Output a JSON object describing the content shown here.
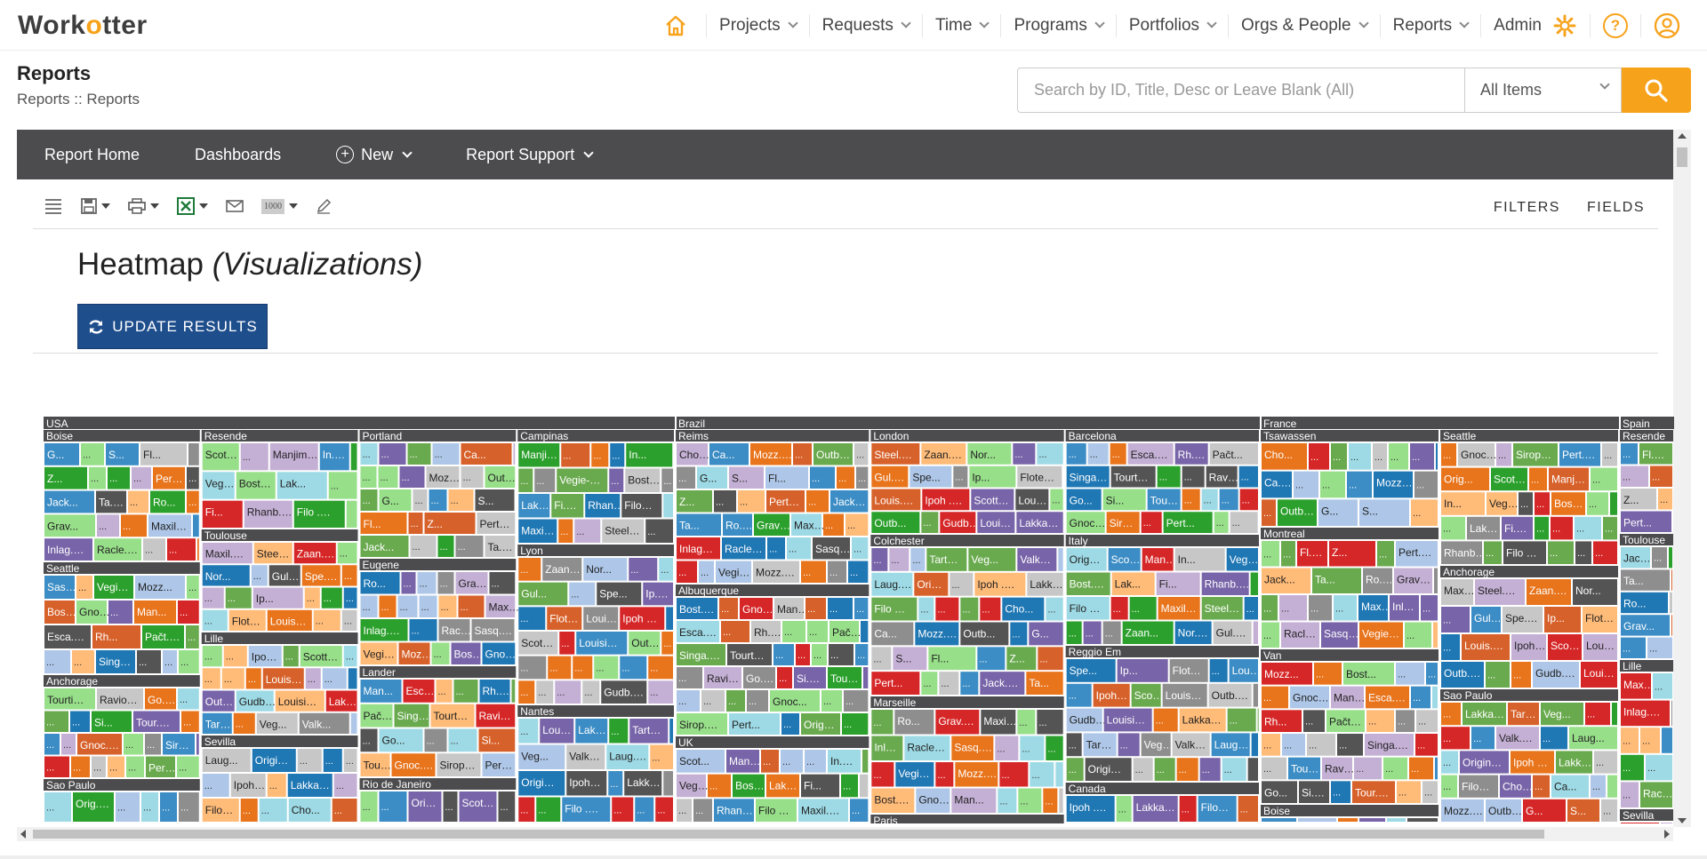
{
  "app": {
    "logo_pre": "Work",
    "logo_mid": "o",
    "logo_post": "tter"
  },
  "nav": {
    "items": [
      {
        "label": "Projects"
      },
      {
        "label": "Requests"
      },
      {
        "label": "Time"
      },
      {
        "label": "Programs"
      },
      {
        "label": "Portfolios"
      },
      {
        "label": "Orgs & People"
      },
      {
        "label": "Reports"
      }
    ],
    "admin": "Admin",
    "help": "?"
  },
  "page": {
    "title": "Reports",
    "breadcrumb": "Reports :: Reports"
  },
  "search": {
    "placeholder": "Search by ID, Title, Desc or Leave Blank (All)",
    "scope": "All Items"
  },
  "menu": {
    "home": "Report Home",
    "dashboards": "Dashboards",
    "new": "New",
    "support": "Report Support"
  },
  "toolbar": {
    "filters": "FILTERS",
    "fields": "FIELDS",
    "page_size": "1000"
  },
  "viz": {
    "title": "Heatmap ",
    "subtitle": "(Visualizations)",
    "update_label": "UPDATE RESULTS"
  },
  "colors": {
    "accent": "#f7a21b",
    "dark_bar": "#4c4c4e",
    "button": "#1f4e8c",
    "palette": [
      "#6aaa4f",
      "#3c8dc5",
      "#e8741c",
      "#7864a8",
      "#8e8e8e",
      "#aec7e8",
      "#ffbb78",
      "#98df8a",
      "#c5b0d5",
      "#c7c7c7",
      "#2ca02c",
      "#1f77b4",
      "#d62728",
      "#d7612a",
      "#9edae5",
      "#545454"
    ]
  },
  "heatmap": {
    "groups": [
      {
        "label": "USA",
        "w": 0.322
      },
      {
        "label": "Brazil",
        "w": 0.298
      },
      {
        "label": "France",
        "w": 0.183
      },
      {
        "label": "Spain",
        "w": 0.028
      }
    ],
    "cities": [
      "Boise",
      "Seattle",
      "Anchorage",
      "Sao Paulo",
      "Resende",
      "Toulouse",
      "Lille",
      "Sevilla",
      "Portland",
      "Eugene",
      "Lander",
      "Rio de Janeiro",
      "Campinas",
      "Lyon",
      "Nantes",
      "Reims",
      "Albuquerque",
      "UK",
      "London",
      "Colchester",
      "Marseille",
      "Paris",
      "Barcelona",
      "Italy",
      "Reggio Em",
      "Canada",
      "Tsawassen",
      "Montreal",
      "Van"
    ],
    "cell_labels": [
      "G...",
      "S...",
      "Fl...",
      "Z...",
      "Pert...",
      "Jack...",
      "Ta...",
      "Ro...",
      "Grav...",
      "Maxil...",
      "Inlag...",
      "Racle...",
      "Sasq...",
      "Vegie-...",
      "Mozz...",
      "Bost...",
      "Gnoc...",
      "Man...",
      "Esca...",
      "Rh...",
      "Pačt...",
      "Singa...",
      "Tourtia...",
      "Ravio...",
      "Go...",
      "Si...",
      "Tour...",
      "Gnoc...",
      "Sirop...",
      "Pert...",
      "Orig...",
      "Scot...",
      "Manjim...",
      "In...",
      "Vegie-...",
      "Bost...",
      "Lak...",
      "Fi...",
      "Rhanb...",
      "Filo ...",
      "Maxil...",
      "Steel...",
      "Zaan...",
      "Nor...",
      "Gul...",
      "Spe...",
      "Ip...",
      "Flote...",
      "Louis...",
      "Ipoh ...",
      "Scottis...",
      "Louisian...",
      "Outb...",
      "Gudb...",
      "Louisia...",
      "Lakkal...",
      "Tarte au...",
      "Veg...",
      "Valk...",
      "Laug...",
      "Original...",
      "Ipoh ...",
      "Lakkal...",
      "Filo ...",
      "Cho...",
      "Ca...",
      "Mozz...",
      "Outb..."
    ]
  }
}
